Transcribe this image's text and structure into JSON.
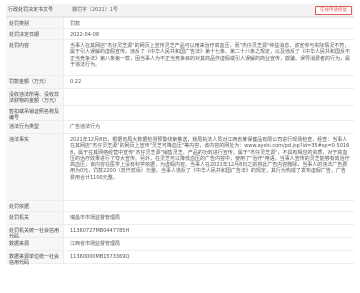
{
  "header": {
    "label": "行政处罚决定书文号",
    "value": "魏罚字〔2021〕1号",
    "badge": "在线申请修复"
  },
  "rows": [
    {
      "label": "处罚类别",
      "value": "罚款"
    },
    {
      "label": "处罚决定日期",
      "value": "2022-04-08"
    },
    {
      "label": "处罚内容",
      "value": "当事人在其网店\"杰仔灵芝源\"的网页上宣传灵芝产品可以用来治疗高血压，而\"杰仔灵芝源\"仲益消息，该宣传与实际情况不符，属于引人误解的虚假宣传。违反了《中华人民共和国广告法》第十七条、第二十八条之规定，以及违反了《中华人民共和国反不正当竞争法》第八条第一款，因当事人为不正当竞争目的对其商品作虚假或引人误解的商业宣传，欺骗、误导消费者的行为，属于违法行为。"
    },
    {
      "label": "罚款金额（万元）",
      "value": "0.22"
    },
    {
      "label": "没收违法所得、没收非法财物的金额（万元）",
      "value": ""
    },
    {
      "label": "暂扣或吊销证照名称及编号",
      "value": ""
    },
    {
      "label": "违法行为类型",
      "value": "广告违法行为"
    },
    {
      "label": "违法事实",
      "value": "2021年12月8日，根据省局大数据检测预警线索推送，我局执法人员对江西省某保健品有限公司进行现场检查，经查：当事人在其网店\"杰仔灵芝源\"的网页上宣传\"灵芝可降血压\"等内容，该内容的网址为：www.ayshi.com/pd.jsp?id=35#sp=0 50168，属于在其网络经营中宣传\"杰仔灵芝源\"销售灵芝、产品的功效进行宣传，属于\"杰仔灵芝源\"，不具有相应的资质，对于高血压的治疗效果进行了夸大宣传。另外，在灵芝可以降低血压的广告内容中，使用了\"治疗\"用语，当事人宣传的灵芝能够有效治疗高血压，该内容在医学上没有科学依据，为虚假内容。当事人在2021年12月8日之前将此广告内容删除，当事人的违法广告费用为0元，罚款2200（贰仟贰佰）元整。当事人违反了《中华人民共和国广告法》的规定，其行为构成了发布虚假广告。广告费用合计1100元整。"
    },
    {
      "label": "处罚依据",
      "value": ""
    },
    {
      "label": "处罚机关",
      "value": "瑞昌市市场监督管理局"
    },
    {
      "label": "处罚机关统一社会信用代码",
      "value": "11360727MB0447785H"
    },
    {
      "label": "数据来源",
      "value": "江西省市场监督管理局"
    },
    {
      "label": "数据来源单位统一社会信用代码",
      "value": "11360000MB1573369Q"
    }
  ]
}
